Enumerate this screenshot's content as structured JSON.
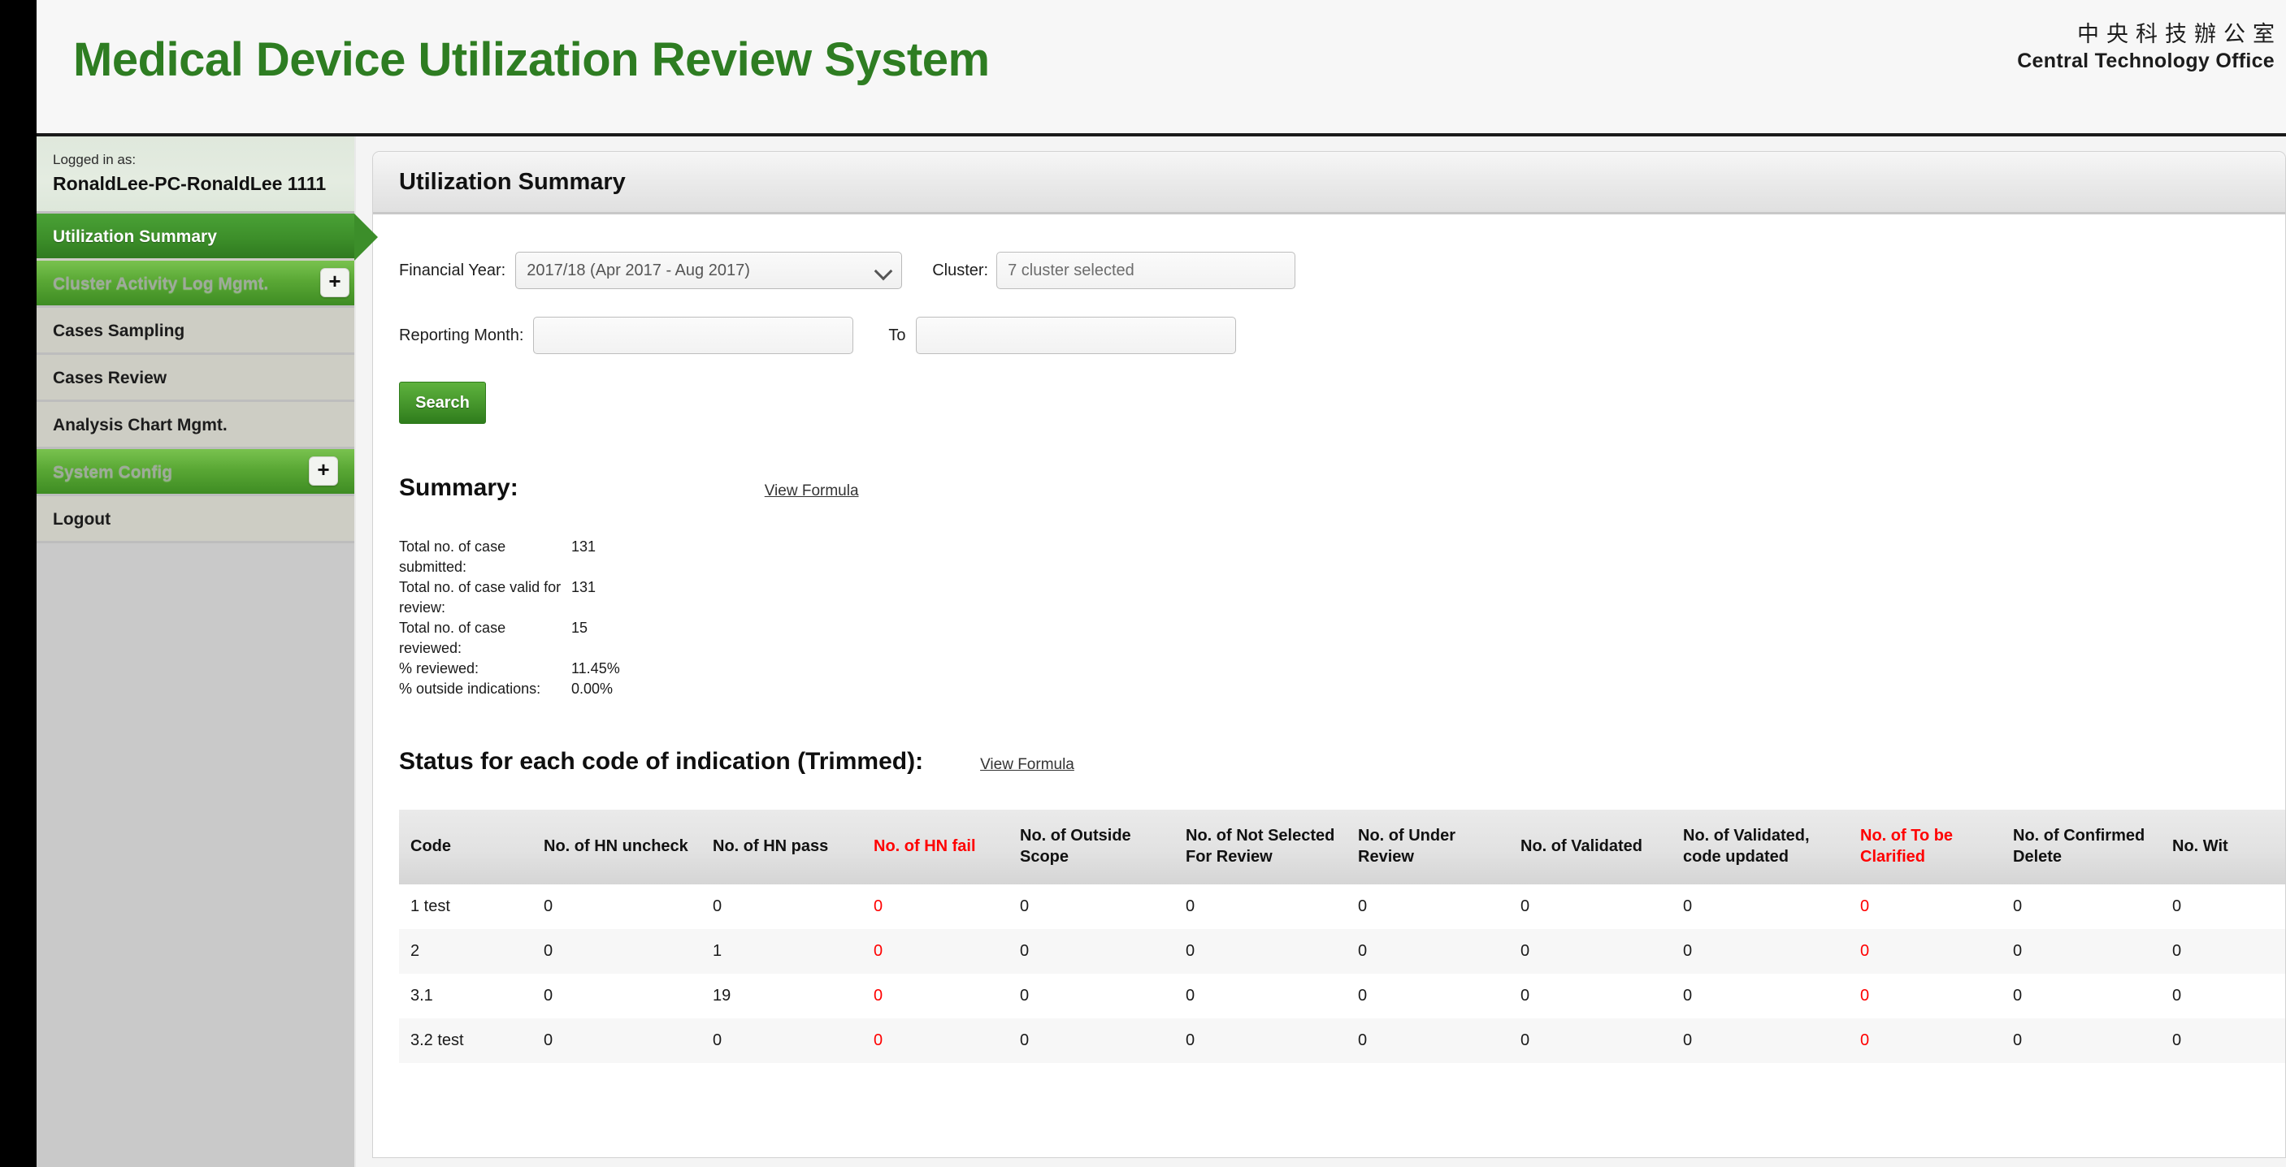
{
  "banner": {
    "app_title": "Medical Device Utilization Review System",
    "logo_cn": "中央科技辦公室",
    "logo_en": "Central Technology Office"
  },
  "sidebar": {
    "logged_in_label": "Logged in as:",
    "user_name": "RonaldLee-PC-RonaldLee 1111",
    "items": [
      {
        "label": "Utilization Summary",
        "state": "active"
      },
      {
        "label": "Cluster Activity Log Mgmt.",
        "state": "group",
        "expand": "+"
      },
      {
        "label": "Cases Sampling",
        "state": "plain"
      },
      {
        "label": "Cases Review",
        "state": "plain"
      },
      {
        "label": "Analysis Chart Mgmt.",
        "state": "plain"
      },
      {
        "label": "System Config",
        "state": "group",
        "expand": "+"
      },
      {
        "label": "Logout",
        "state": "plain"
      }
    ]
  },
  "panel": {
    "title": "Utilization Summary"
  },
  "form": {
    "financial_year_label": "Financial Year:",
    "financial_year_value": "2017/18 (Apr 2017 - Aug 2017)",
    "cluster_label": "Cluster:",
    "cluster_value": "7 cluster selected",
    "reporting_month_label": "Reporting Month:",
    "reporting_month_value": "",
    "to_label": "To",
    "reporting_to_value": "",
    "search_label": "Search"
  },
  "summary": {
    "title": "Summary:",
    "view_formula": "View Formula",
    "stats": [
      {
        "label": "Total no. of case submitted:",
        "value": "131"
      },
      {
        "label": "Total no. of case valid for review:",
        "value": "131"
      },
      {
        "label": "Total no. of case reviewed:",
        "value": "15"
      },
      {
        "label": "% reviewed:",
        "value": "11.45%"
      },
      {
        "label": "% outside indications:",
        "value": "0.00%"
      }
    ]
  },
  "status_table": {
    "title": "Status for each code of indication (Trimmed):",
    "view_formula": "View Formula",
    "columns": [
      {
        "label": "Code",
        "red": false
      },
      {
        "label": "No. of HN uncheck",
        "red": false
      },
      {
        "label": "No. of HN pass",
        "red": false
      },
      {
        "label": "No. of HN fail",
        "red": true
      },
      {
        "label": "No. of Outside Scope",
        "red": false
      },
      {
        "label": "No. of Not Selected For Review",
        "red": false
      },
      {
        "label": "No. of Under Review",
        "red": false
      },
      {
        "label": "No. of Validated",
        "red": false
      },
      {
        "label": "No. of Validated, code updated",
        "red": false
      },
      {
        "label": "No. of To be Clarified",
        "red": true
      },
      {
        "label": "No. of Confirmed Delete",
        "red": false
      },
      {
        "label": "No. Wit",
        "red": false
      }
    ],
    "rows": [
      [
        "1 test",
        "0",
        "0",
        "0",
        "0",
        "0",
        "0",
        "0",
        "0",
        "0",
        "0",
        "0"
      ],
      [
        "2",
        "0",
        "1",
        "0",
        "0",
        "0",
        "0",
        "0",
        "0",
        "0",
        "0",
        "0"
      ],
      [
        "3.1",
        "0",
        "19",
        "0",
        "0",
        "0",
        "0",
        "0",
        "0",
        "0",
        "0",
        "0"
      ],
      [
        "3.2 test",
        "0",
        "0",
        "0",
        "0",
        "0",
        "0",
        "0",
        "0",
        "0",
        "0",
        "0"
      ]
    ]
  },
  "colors": {
    "brand_green": "#2e7d22",
    "accent_green": "#3c8e2a",
    "alert_red": "#ff0000"
  }
}
